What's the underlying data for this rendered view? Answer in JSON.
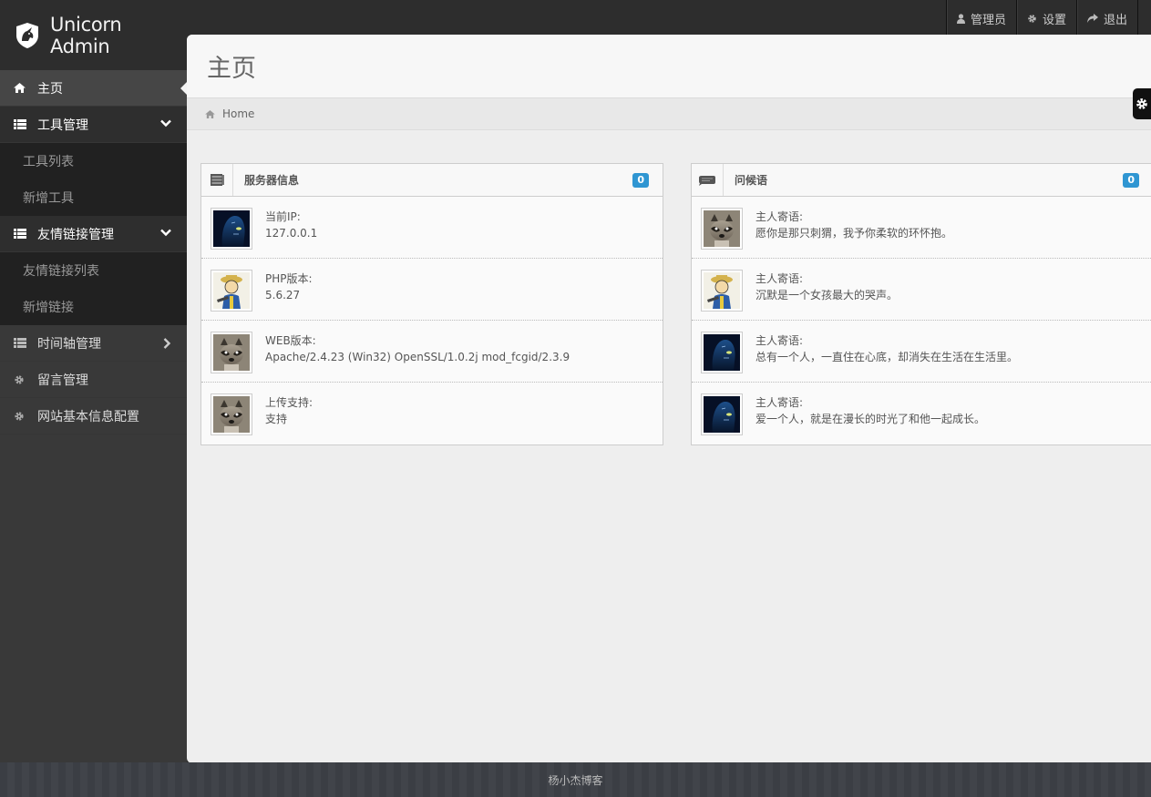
{
  "brand": {
    "title": "Unicorn Admin"
  },
  "usernav": [
    {
      "name": "user-menu",
      "icon": "user-icon",
      "label": "管理员"
    },
    {
      "name": "settings-menu",
      "icon": "gear-icon",
      "label": "设置"
    },
    {
      "name": "logout-menu",
      "icon": "share-icon",
      "label": "退出"
    }
  ],
  "sidebar": {
    "home": "主页",
    "tools": "工具管理",
    "tool_list": "工具列表",
    "tool_add": "新增工具",
    "links": "友情链接管理",
    "link_list": "友情链接列表",
    "link_add": "新增链接",
    "timeline": "时间轴管理",
    "messages": "留言管理",
    "site_config": "网站基本信息配置"
  },
  "content": {
    "page_title": "主页",
    "breadcrumb": "Home"
  },
  "server_panel": {
    "title": "服务器信息",
    "badge": "0",
    "rows": [
      {
        "label": "当前IP:",
        "value": "127.0.0.1",
        "avatar": "avatar-blue"
      },
      {
        "label": "PHP版本:",
        "value": "5.6.27",
        "avatar": "avatar-vault"
      },
      {
        "label": "WEB版本:",
        "value": "Apache/2.4.23 (Win32) OpenSSL/1.0.2j mod_fcgid/2.3.9",
        "avatar": "avatar-raccoon"
      },
      {
        "label": "上传支持:",
        "value": "支持",
        "avatar": "avatar-raccoon"
      }
    ]
  },
  "greet_panel": {
    "title": "问候语",
    "badge": "0",
    "rows": [
      {
        "label": "主人寄语:",
        "value": "愿你是那只刺猬，我予你柔软的环怀抱。",
        "avatar": "avatar-raccoon"
      },
      {
        "label": "主人寄语:",
        "value": "沉默是一个女孩最大的哭声。",
        "avatar": "avatar-vault"
      },
      {
        "label": "主人寄语:",
        "value": "总有一个人，一直住在心底，却消失在生活在生活里。",
        "avatar": "avatar-blue"
      },
      {
        "label": "主人寄语:",
        "value": "爱一个人，就是在漫长的时光了和他一起成长。",
        "avatar": "avatar-blue"
      }
    ]
  },
  "footer": {
    "text": "杨小杰博客"
  }
}
